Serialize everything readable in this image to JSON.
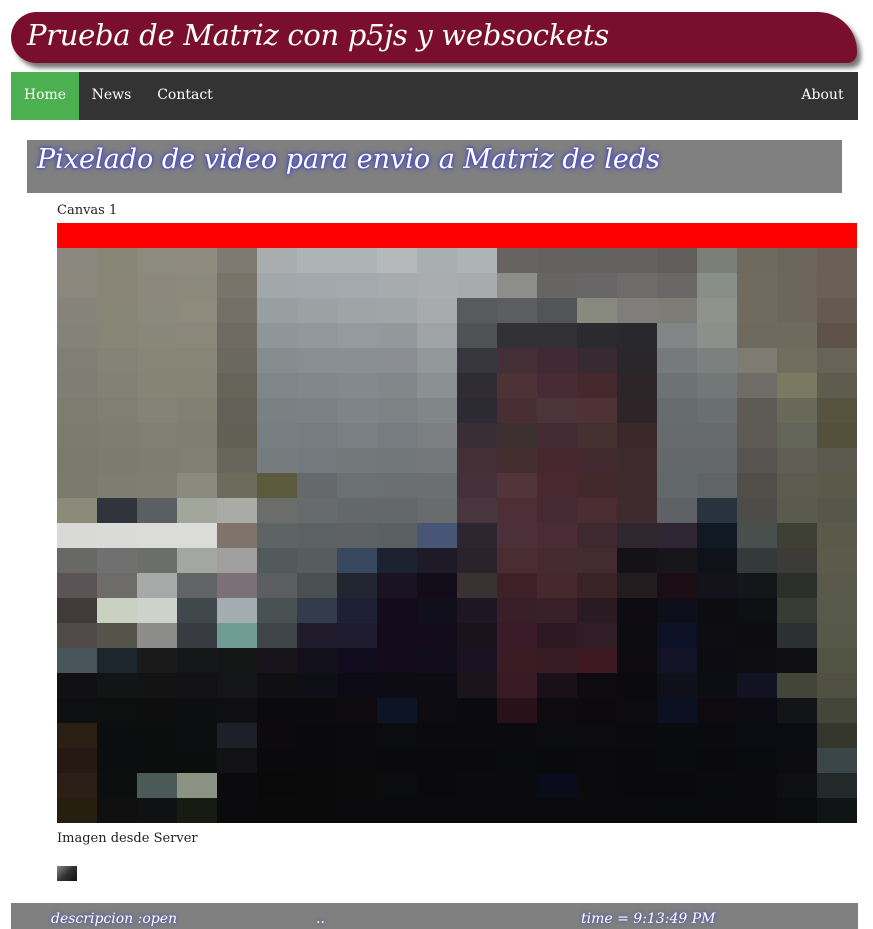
{
  "header": {
    "title": "Prueba de Matriz con p5js y websockets"
  },
  "nav": {
    "items": [
      {
        "label": "Home",
        "active": true
      },
      {
        "label": "News"
      },
      {
        "label": "Contact"
      },
      {
        "label": "About"
      }
    ]
  },
  "subtitle": "Pixelado de video para envio a Matriz de leds",
  "canvas_label": "Canvas 1",
  "server_label": "Imagen desde Server",
  "footer": {
    "description": "descripcion :open",
    "middle": "..",
    "time": "time = 9:13:49 PM"
  },
  "colors": {
    "header_bg": "#7a0e2f",
    "nav_bg": "#333333",
    "nav_active": "#4caf50",
    "panel_gray": "#808080",
    "canvas_bar": "#ff0000"
  },
  "pixel_grid": {
    "cols": 20,
    "rows": 23,
    "cells": [
      [
        "#8a877e",
        "#878677",
        "#8d8a7e",
        "#8f8c7f",
        "#7e7a72",
        "#a9adae",
        "#aeb3b5",
        "#aeb3b5",
        "#b6b9ba",
        "#a9aeb0",
        "#aeb3b5",
        "#676361",
        "#646160",
        "#64625f",
        "#64615e",
        "#615e5c",
        "#7b7f77",
        "#6f6a5e",
        "#6b655b",
        "#6a6058"
      ],
      [
        "#8b877c",
        "#898677",
        "#8c897c",
        "#8c8a7c",
        "#797469",
        "#a2a7a9",
        "#a2a8ab",
        "#a4a9ad",
        "#a7abae",
        "#a9adae",
        "#a7abad",
        "#8d8d8c",
        "#676464",
        "#676565",
        "#6e6b6a",
        "#6a6867",
        "#888e88",
        "#706b5e",
        "#6c665b",
        "#6a6058"
      ],
      [
        "#85837a",
        "#878676",
        "#8b897c",
        "#8e8b7c",
        "#736f66",
        "#999fa1",
        "#9ca1a4",
        "#9fa4a7",
        "#a0a5a8",
        "#a8aaab",
        "#595a5d",
        "#5b5d60",
        "#525458",
        "#88897f",
        "#7f7e7a",
        "#7d7c77",
        "#8f938c",
        "#706b5e",
        "#6c665b",
        "#655a51"
      ],
      [
        "#84837a",
        "#868676",
        "#888779",
        "#8a887a",
        "#6f6b62",
        "#8f9598",
        "#91979a",
        "#949a9d",
        "#93989b",
        "#a0a3a5",
        "#505155",
        "#323235",
        "#333036",
        "#2b2a2f",
        "#28292d",
        "#818586",
        "#8b908b",
        "#6f6a5e",
        "#6e6a5d",
        "#5f5248"
      ],
      [
        "#807f75",
        "#848274",
        "#868576",
        "#878676",
        "#6a685f",
        "#868c8e",
        "#888e91",
        "#8a8f93",
        "#8a8e92",
        "#92979a",
        "#38363f",
        "#432f35",
        "#412a33",
        "#382a31",
        "#2a272c",
        "#767a7b",
        "#7c807e",
        "#7d7b72",
        "#716d5e",
        "#686357"
      ],
      [
        "#7f7e74",
        "#828173",
        "#858475",
        "#858475",
        "#666459",
        "#7f8588",
        "#82888a",
        "#838a8d",
        "#82878a",
        "#8b9093",
        "#2f2c34",
        "#4d3237",
        "#472c35",
        "#45292f",
        "#2e2528",
        "#6d7273",
        "#727778",
        "#6e6c67",
        "#7a7a63",
        "#5e5b4f"
      ],
      [
        "#7d7c71",
        "#807f71",
        "#838274",
        "#818072",
        "#636157",
        "#7b8183",
        "#7b8285",
        "#7e8487",
        "#7d8285",
        "#818689",
        "#2c2a32",
        "#4a2e35",
        "#4d333a",
        "#4e3236",
        "#2f2529",
        "#676c6e",
        "#6a6f70",
        "#5e5a55",
        "#69695a",
        "#57533f"
      ],
      [
        "#7c7b70",
        "#7e7d70",
        "#808072",
        "#7f7e71",
        "#626055",
        "#787e81",
        "#767c80",
        "#797f82",
        "#777c80",
        "#7b7f82",
        "#3a2e36",
        "#3b302f",
        "#432a33",
        "#43302f",
        "#3a282b",
        "#676b6c",
        "#676b6c",
        "#5d5955",
        "#646559",
        "#55503b"
      ],
      [
        "#7a796d",
        "#7c7b6e",
        "#7e7d6f",
        "#807f72",
        "#68665a",
        "#767b7e",
        "#73797c",
        "#73787b",
        "#72777a",
        "#74787b",
        "#433036",
        "#452e30",
        "#47282f",
        "#432a30",
        "#3d2a2d",
        "#64686a",
        "#646868",
        "#575350",
        "#5e5e54",
        "#5a5a4e"
      ],
      [
        "#7b7a6e",
        "#7e7d70",
        "#7f7e71",
        "#8a8a7e",
        "#6c6b5c",
        "#5c5a3c",
        "#65696b",
        "#6b7073",
        "#6b6f72",
        "#6c6f72",
        "#45313a",
        "#51353b",
        "#49292f",
        "#44292c",
        "#3d2a2c",
        "#62676a",
        "#606465",
        "#514d48",
        "#5c5b4f",
        "#5a5a4b"
      ],
      [
        "#8c8b7a",
        "#31343c",
        "#5a5f62",
        "#a3a69d",
        "#a9aba7",
        "#6a6d6a",
        "#676b6b",
        "#64686a",
        "#63676a",
        "#696c6d",
        "#48353d",
        "#4e2f37",
        "#452a33",
        "#4a2c33",
        "#3d2b2e",
        "#5e6266",
        "#283340",
        "#4d4c48",
        "#5a5a4d",
        "#56574a"
      ],
      [
        "#d9dad8",
        "#dadbd9",
        "#dbdcda",
        "#dbdcda",
        "#7e746b",
        "#5e6363",
        "#5c6162",
        "#5e6263",
        "#5b6061",
        "#475576",
        "#2d2631",
        "#4b2f39",
        "#4a2b36",
        "#3f2931",
        "#30262e",
        "#302633",
        "#111922",
        "#48504d",
        "#3e4036",
        "#5a5a4a"
      ],
      [
        "#686866",
        "#707070",
        "#6c6e6a",
        "#a3a6a1",
        "#a09f9d",
        "#525a5b",
        "#575c5d",
        "#36475f",
        "#1d2232",
        "#1f1a28",
        "#2b222b",
        "#4a2c33",
        "#462a31",
        "#442a31",
        "#141217",
        "#17161b",
        "#0f1218",
        "#34393a",
        "#3c3b37",
        "#5b5b4c"
      ],
      [
        "#5b5355",
        "#6e6c6a",
        "#a6a9a8",
        "#626364",
        "#7a7075",
        "#5a5e5f",
        "#4a4f52",
        "#222631",
        "#1a1422",
        "#130c19",
        "#3a3132",
        "#3e2029",
        "#46292e",
        "#3a2327",
        "#231c1f",
        "#1a0d14",
        "#14131b",
        "#14161a",
        "#2a2f2a",
        "#58594b"
      ],
      [
        "#403a38",
        "#cbd1c1",
        "#ced2cb",
        "#40484b",
        "#a3acb0",
        "#4a5153",
        "#343b4b",
        "#1e2036",
        "#130b1c",
        "#120f1c",
        "#1e1623",
        "#3a1f28",
        "#3a2028",
        "#2a1b22",
        "#0f0b12",
        "#0e0f1b",
        "#0d0c11",
        "#0d0f13",
        "#363c33",
        "#57594a"
      ],
      [
        "#504a48",
        "#55544b",
        "#8c8c8a",
        "#383b3f",
        "#6f9d95",
        "#3f4549",
        "#1f1b2a",
        "#1e1b2f",
        "#140a1b",
        "#130c1a",
        "#1a121c",
        "#391c27",
        "#2c1922",
        "#311d26",
        "#0c0b0d",
        "#0d1229",
        "#0d0d12",
        "#0c0c11",
        "#2c3032",
        "#56584a"
      ],
      [
        "#48565b",
        "#1d262c",
        "#1b1a1b",
        "#161719",
        "#141515",
        "#17131a",
        "#11101b",
        "#110d1e",
        "#130a1a",
        "#110d1b",
        "#1b1321",
        "#3b1c24",
        "#371c26",
        "#3d1820",
        "#0e0b10",
        "#131227",
        "#0e0c13",
        "#0e0d12",
        "#0f0f12",
        "#525443"
      ],
      [
        "#111113",
        "#131415",
        "#131313",
        "#121214",
        "#141519",
        "#101013",
        "#0f0f17",
        "#0c0b14",
        "#0c0a12",
        "#0d0b14",
        "#1b141a",
        "#381b24",
        "#1a1018",
        "#0e0b0f",
        "#0b0a0e",
        "#10101a",
        "#0d0e13",
        "#121222",
        "#424538",
        "#4f5042"
      ],
      [
        "#0e0f10",
        "#0e0f0f",
        "#0e0e0e",
        "#0d0e0f",
        "#0f0f11",
        "#0b0b0d",
        "#0b0a0d",
        "#0d0b0f",
        "#0d1424",
        "#0c0b11",
        "#0c0a11",
        "#281118",
        "#0d0b0e",
        "#0c0a0d",
        "#0c0b0f",
        "#0b1120",
        "#0d0b10",
        "#0c0b12",
        "#121415",
        "#45463a"
      ],
      [
        "#2b1e12",
        "#0b0d0e",
        "#0c0d0d",
        "#0d0e0f",
        "#1f1f29",
        "#0c0a0f",
        "#0a090b",
        "#0b0a0c",
        "#0b0c0f",
        "#0b0a0d",
        "#0b0a0d",
        "#0b0a0d",
        "#0b0c10",
        "#0c0b0e",
        "#0b0b0d",
        "#0a0b0e",
        "#0b0b0f",
        "#0b0c11",
        "#0b0c11",
        "#35372e"
      ],
      [
        "#241913",
        "#0b0d0e",
        "#0c0e0d",
        "#0c0e0e",
        "#121215",
        "#0a090b",
        "#0a0a0c",
        "#0b0a0c",
        "#0a0a0d",
        "#0a090c",
        "#0a0a0d",
        "#0a0b0d",
        "#0a0a0d",
        "#0b0a0d",
        "#0a0a0c",
        "#0a0b0e",
        "#0a0a0d",
        "#0a0b0f",
        "#0c0c10",
        "#3a4647"
      ],
      [
        "#2a1e16",
        "#0d0f0f",
        "#4b5a57",
        "#8c9383",
        "#0b0b0d",
        "#0a090a",
        "#0a0a0b",
        "#0b0b0c",
        "#0b0c0e",
        "#0a0a0c",
        "#0b0a0c",
        "#0b0a0d",
        "#0b0c1b",
        "#0b0b0e",
        "#0a0a0c",
        "#0a0a0d",
        "#0a0b0e",
        "#0b0b0e",
        "#0d0f11",
        "#222928"
      ],
      [
        "#261e0f",
        "#0e0f0e",
        "#101113",
        "#181a14",
        "#0b0b0d",
        "#0b0a0b",
        "#0a0a0b",
        "#0b0a0d",
        "#0b0b0d",
        "#0b0b0d",
        "#0b0a0c",
        "#0b0a0d",
        "#0b0b0d",
        "#0b0a0d",
        "#0b0a0c",
        "#0a0b0d",
        "#0b0b0d",
        "#0b0b0e",
        "#0b0c0d",
        "#101414"
      ]
    ]
  }
}
